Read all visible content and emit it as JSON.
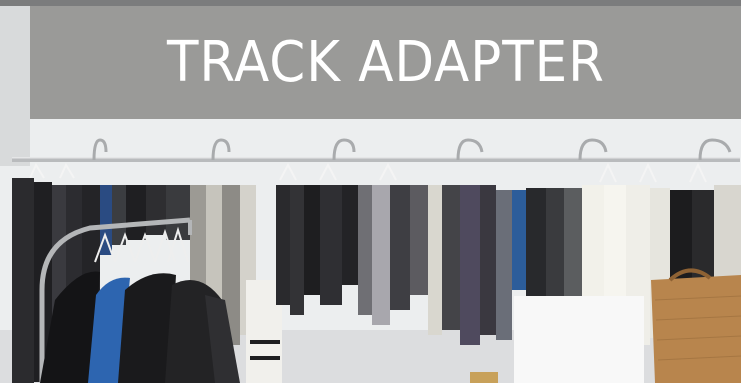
{
  "banner": {
    "title": "TRACK ADAPTER"
  },
  "photo": {
    "subject": "clothing-rack-display",
    "colors": {
      "wall": "#eceeef",
      "top_strip": "#7b7c7d",
      "banner": "#9a9a98",
      "rail": "#b9bbbd",
      "bag": "#b8854d"
    }
  }
}
